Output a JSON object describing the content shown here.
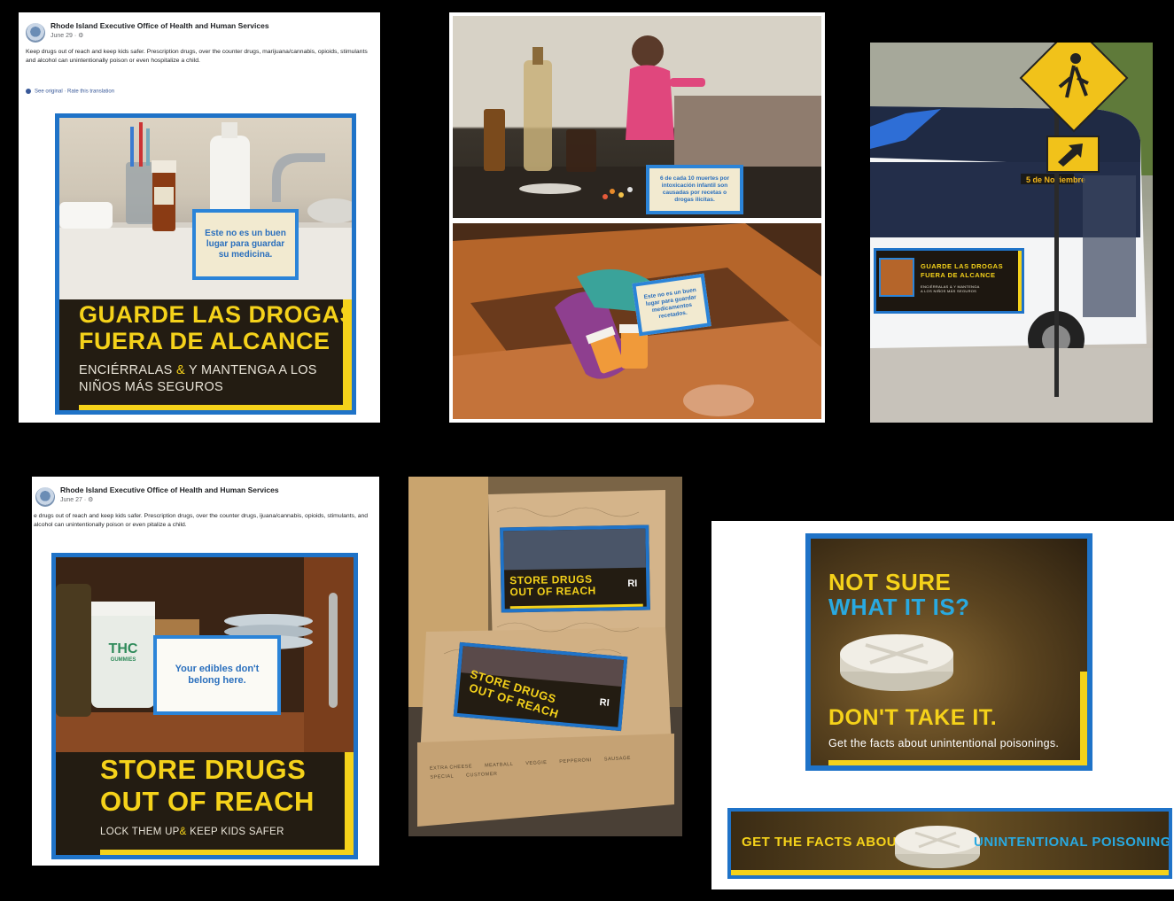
{
  "panel_es_fb": {
    "org": "Rhode Island Executive Office of Health and Human Services",
    "date": "June 29 · ⚙",
    "body": "Keep drugs out of reach and keep kids safer. Prescription drugs, over the counter drugs, marijuana/cannabis, opioids, stimulants and alcohol can unintentionally poison or even hospitalize a child.",
    "links": "See original · Rate this translation",
    "card_text": "Este no es un buen lugar para guardar su medicina.",
    "headline_1": "GUARDE LAS DROGAS",
    "headline_2": "FUERA DE ALCANCE",
    "sub_1a": "ENCIÉRRALAS ",
    "sub_amp": "&",
    "sub_1b": " Y MANTENGA A LOS",
    "sub_2": "NIÑOS MÁS SEGUROS"
  },
  "panel_photos_top": {
    "card_top": "6 de cada 10 muertes por intoxicación infantil son causadas por recetas o drogas ilícitas.",
    "card_drawer": "Este no es un buen lugar para guardar medicamentos recetados."
  },
  "panel_bus": {
    "route_sign": "5 de Noviembre",
    "ad_line_1": "GUARDE LAS DROGAS",
    "ad_line_2": "FUERA DE ALCANCE",
    "ad_sub": "ENCIÉRRALAS & Y MANTENGA A LOS NIÑOS MÁS SEGUROS"
  },
  "panel_en_fb": {
    "org": "Rhode Island Executive Office of Health and Human Services",
    "date": "June 27 · ⚙",
    "body": "e drugs out of reach and keep kids safer. Prescription drugs, over the counter drugs, ijuana/cannabis, opioids, stimulants, and alcohol can unintentionally poison or even pitalize a child.",
    "jar_label": "THC",
    "jar_label_small": "GUMMIES",
    "card_text": "Your edibles don't belong here.",
    "headline_1": "STORE DRUGS",
    "headline_2": "OUT OF REACH",
    "sub_a": "LOCK THEM UP",
    "sub_amp": "&",
    "sub_b": " KEEP KIDS SAFER"
  },
  "panel_pizza": {
    "sticker_line_1": "STORE DRUGS",
    "sticker_line_2": "OUT OF REACH",
    "sticker_logo": "RI",
    "box_words": [
      "EXTRA CHEESE",
      "MEATBALL",
      "VEGGIE",
      "PEPPERONI",
      "SAUSAGE",
      "SPECIAL",
      "CUSTOMER"
    ]
  },
  "panel_pill": {
    "line_1": "NOT SURE",
    "line_2": "WHAT IT IS?",
    "line_3": "DON'T TAKE IT.",
    "sub": "Get the facts about unintentional poisonings."
  },
  "panel_banner": {
    "left": "GET THE FACTS ABOUT",
    "right": "UNINTENTIONAL POISONINGS."
  },
  "colors": {
    "background": "#000000",
    "campaign_blue": "#1f73c8",
    "campaign_yellow": "#f5d21a",
    "headline_cyan": "#29a9e0",
    "dark_brown": "#231c12"
  }
}
